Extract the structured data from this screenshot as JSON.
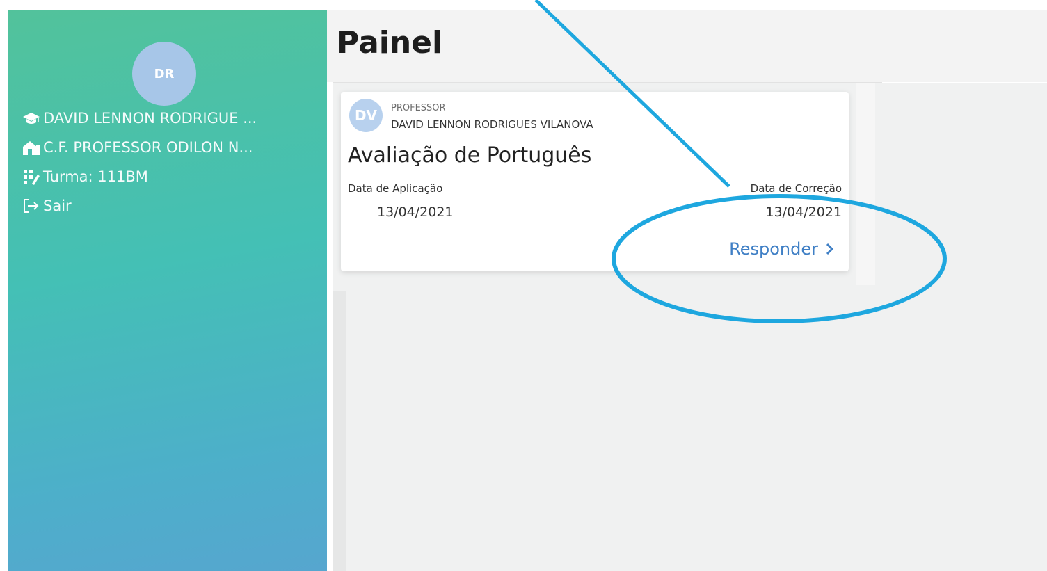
{
  "sidebar": {
    "avatar_initials": "DR",
    "student_name": "DAVID LENNON RODRIGUE ...",
    "school_name": "C.F. PROFESSOR ODILON N...",
    "class_label": "Turma: 111BM",
    "logout_label": "Sair"
  },
  "header": {
    "title": "Painel"
  },
  "card": {
    "avatar_initials": "DV",
    "role": "PROFESSOR",
    "teacher_name": "DAVID LENNON RODRIGUES VILANOVA",
    "title": "Avaliação de Português",
    "application_label": "Data de Aplicação",
    "application_date": "13/04/2021",
    "correction_label": "Data de Correção",
    "correction_date": "13/04/2021",
    "respond_label": "Responder"
  },
  "icons": {
    "student": "graduation-cap-icon",
    "school": "school-building-icon",
    "class": "grid-icon",
    "logout": "logout-icon",
    "respond": "chevron-right-icon"
  },
  "colors": {
    "sidebar_start": "#52c29b",
    "sidebar_end": "#56a6cf",
    "link": "#3f7fc5",
    "annotation": "#1ea7df"
  }
}
